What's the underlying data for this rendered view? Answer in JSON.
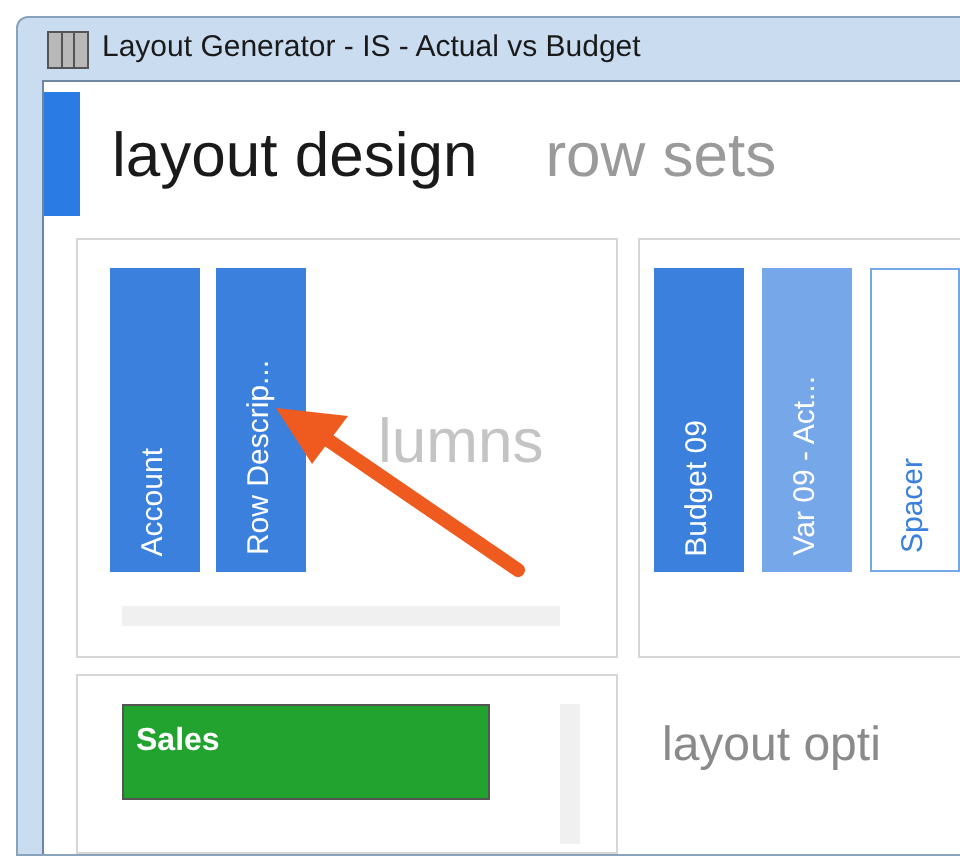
{
  "window": {
    "title": "Layout Generator - IS - Actual vs Budget"
  },
  "tabs": [
    {
      "label": "layout design",
      "selected": true
    },
    {
      "label": "row sets",
      "selected": false
    }
  ],
  "columns_panel": {
    "drop_hint": "lumns",
    "items": [
      {
        "label": "Account",
        "kind": "field"
      },
      {
        "label": "Row Descrip...",
        "kind": "field"
      }
    ]
  },
  "columns_panel_2": {
    "items": [
      {
        "label": "Budget 09",
        "kind": "field"
      },
      {
        "label": "Var 09 - Act...",
        "kind": "calc"
      },
      {
        "label": "Spacer",
        "kind": "spacer"
      }
    ]
  },
  "row_sets_panel": {
    "items": [
      {
        "label": "Sales",
        "color": "#22a32f"
      }
    ]
  },
  "options_heading": "layout opti"
}
